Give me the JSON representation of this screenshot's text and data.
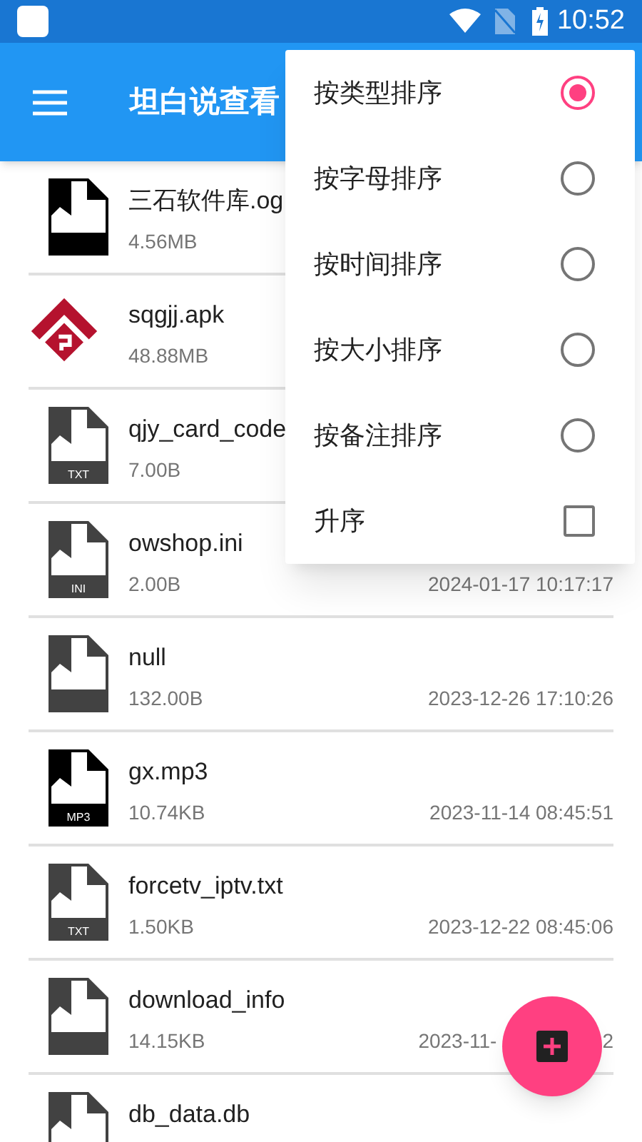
{
  "status_bar": {
    "time": "10:52"
  },
  "app_bar": {
    "title": "坦白说查看"
  },
  "files": [
    {
      "name": "三石软件库.og",
      "size": "4.56MB",
      "kind": "media"
    },
    {
      "name": "sqgjj.apk",
      "size": "48.88MB",
      "kind": "app"
    },
    {
      "name": "qjy_card_code",
      "size": "7.00B",
      "kind": "doc",
      "badge": "TXT"
    },
    {
      "name": "owshop.ini",
      "size": "2.00B",
      "date": "2024-01-17 10:17:17",
      "kind": "doc",
      "badge": "INI"
    },
    {
      "name": "null",
      "size": "132.00B",
      "date": "2023-12-26 17:10:26",
      "kind": "doc"
    },
    {
      "name": "gx.mp3",
      "size": "10.74KB",
      "date": "2023-11-14 08:45:51",
      "kind": "media",
      "badge": "MP3"
    },
    {
      "name": "forcetv_iptv.txt",
      "size": "1.50KB",
      "date": "2023-12-22 08:45:06",
      "kind": "doc",
      "badge": "TXT"
    },
    {
      "name": "download_info",
      "size": "14.15KB",
      "date": "2023-11-",
      "date_tail": "2",
      "kind": "doc"
    },
    {
      "name": "db_data.db",
      "kind": "doc"
    }
  ],
  "sort_menu": [
    {
      "label": "按类型排序",
      "kind": "radio",
      "selected": true
    },
    {
      "label": "按字母排序",
      "kind": "radio",
      "selected": false
    },
    {
      "label": "按时间排序",
      "kind": "radio",
      "selected": false
    },
    {
      "label": "按大小排序",
      "kind": "radio",
      "selected": false
    },
    {
      "label": "按备注排序",
      "kind": "radio",
      "selected": false
    },
    {
      "label": "升序",
      "kind": "checkbox",
      "checked": false
    }
  ]
}
